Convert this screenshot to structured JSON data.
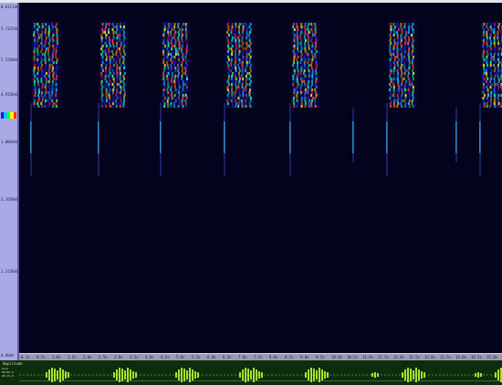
{
  "window": {
    "title": ""
  },
  "frequency_axis": {
    "labels": [
      "0.6111kHz",
      "5.7122kHz",
      "5.5268kHz",
      "4.9156kHz",
      "1.0064kHz",
      "3.1658kHz",
      "1.3158kHz",
      "0.0kHz"
    ]
  },
  "time_axis": {
    "ticks": [
      "0.1s",
      "0.5s",
      "1.0s",
      "1.5s",
      "2.0s",
      "2.5s",
      "3.0s",
      "3.5s",
      "4.0s",
      "4.5s",
      "5.0s",
      "5.5s",
      "6.0s",
      "6.5s",
      "7.0s",
      "7.5s",
      "8.0s",
      "8.5s",
      "9.0s",
      "9.5s",
      "10.0s",
      "10.5s",
      "11.0s",
      "11.5s",
      "12.0s",
      "12.5s",
      "13.0s",
      "13.5s",
      "14.0s",
      "14.5s",
      "15.0s"
    ]
  },
  "waveform": {
    "label": "Amplitude",
    "info": [
      "mono",
      "00:00.0",
      "00:15.0"
    ]
  },
  "colors": {
    "spectrogram_bg": "#03031e",
    "panel": "#a9a9e6",
    "waveform_bg": "#0e2c0e",
    "waveform_fill": "#a6e22e"
  },
  "colorbar": [
    "#1a1aff",
    "#00c8ff",
    "#00ff66",
    "#ffff00",
    "#ff3300"
  ]
}
